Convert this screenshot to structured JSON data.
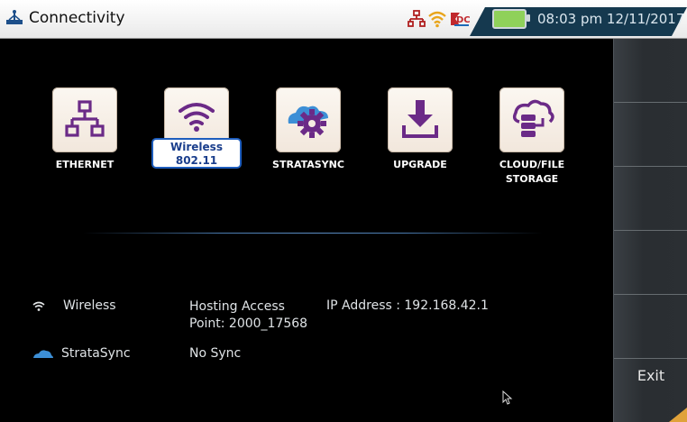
{
  "window": {
    "title": "Connectivity"
  },
  "status_bar": {
    "time": "08:03 pm",
    "date": "12/11/2017"
  },
  "apps": [
    {
      "name": "ethernet",
      "label": "ETHERNET",
      "icon": "network-icon"
    },
    {
      "name": "wireless",
      "label_line1": "Wireless",
      "label_line2": "802.11",
      "icon": "wifi-icon",
      "selected": true
    },
    {
      "name": "stratasync",
      "label": "STRATASYNC",
      "icon": "cloud-gear-icon"
    },
    {
      "name": "upgrade",
      "label": "UPGRADE",
      "icon": "download-icon"
    },
    {
      "name": "cloud-file-storage",
      "label_line1": "CLOUD/FILE",
      "label_line2": "STORAGE",
      "icon": "cloud-server-icon"
    }
  ],
  "status": {
    "wireless": {
      "label": "Wireless",
      "state_line1": "Hosting Access",
      "state_line2": "Point: 2000_17568",
      "ip": "IP Address : 192.168.42.1"
    },
    "stratasync": {
      "label": "StrataSync",
      "state": "No Sync"
    }
  },
  "sidebar": {
    "exit_label": "Exit"
  },
  "colors": {
    "accent": "#6b2a87",
    "select_border": "#1e5dbd",
    "status_tab": "#15394f"
  }
}
